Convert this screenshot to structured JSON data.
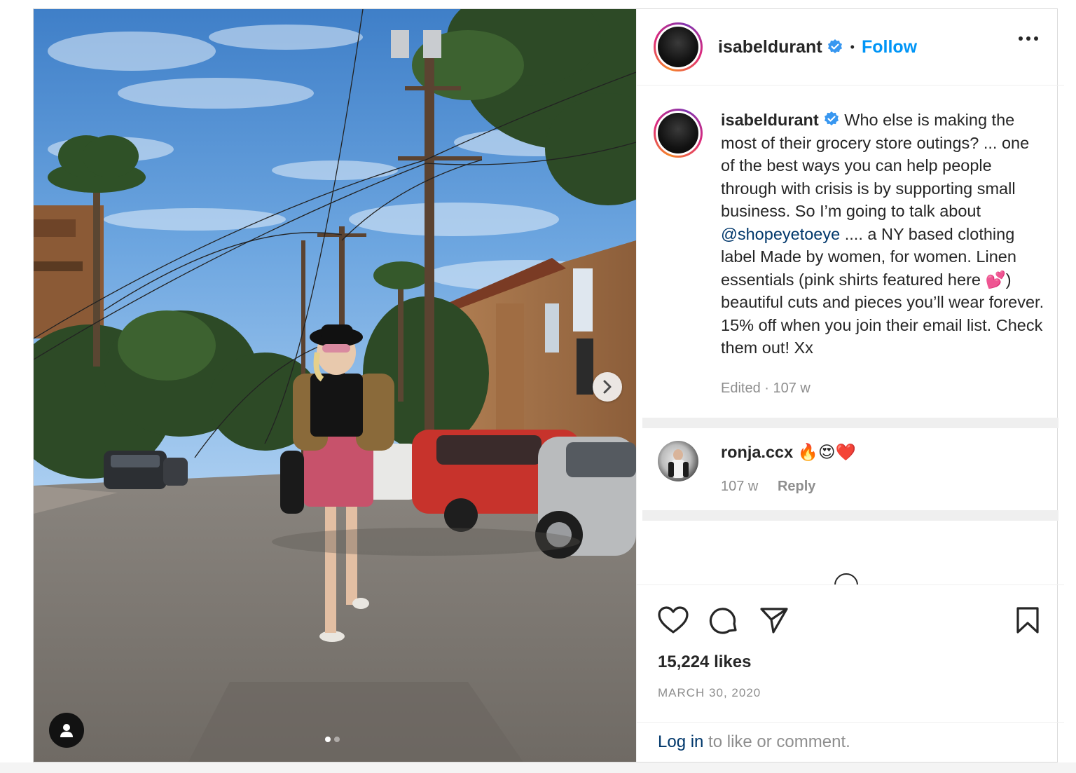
{
  "post": {
    "username": "isabeldurant",
    "verified": true,
    "follow_label": "Follow",
    "separator": "•",
    "caption": {
      "before_mention": "Who else is making the most of their grocery store outings? ... one of the best ways you can help people through with crisis is by supporting small business. So I’m going to talk about ",
      "mention": "@shopeyetoeye",
      "after_mention": " .... a NY based clothing label Made by women, for women. Linen essentials (pink shirts featured here 💕) beautiful cuts and pieces you’ll wear forever. 15% off when you join their email list. Check them out! Xx",
      "meta": "Edited · 107 w"
    },
    "comments": [
      {
        "username": "ronja.ccx",
        "text": "🔥😍❤️",
        "time": "107 w",
        "reply_label": "Reply"
      }
    ],
    "likes": "15,224 likes",
    "date": "MARCH 30, 2020",
    "login": {
      "link": "Log in",
      "rest": " to like or comment."
    },
    "carousel": {
      "current": 1,
      "total": 2
    }
  },
  "icons": {
    "more": "more-options-icon",
    "like": "heart-icon",
    "comment": "comment-bubble-icon",
    "share": "paper-plane-icon",
    "save": "bookmark-icon",
    "next": "chevron-right-icon",
    "tag": "person-icon",
    "verified": "verified-badge-icon"
  },
  "colors": {
    "accent": "#0095f6",
    "mention": "#00376b",
    "muted": "#8e8e8e",
    "text": "#262626",
    "divider": "#efefef"
  }
}
